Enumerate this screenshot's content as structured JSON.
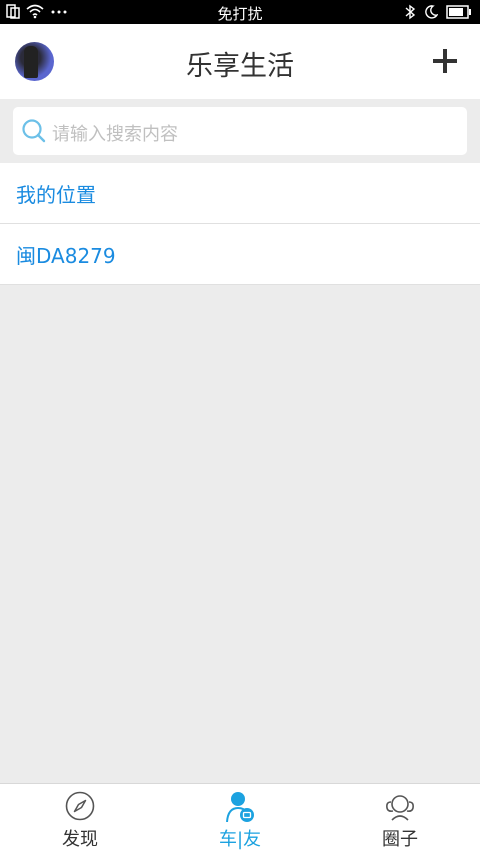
{
  "status_bar": {
    "center_text": "免打扰"
  },
  "header": {
    "title": "乐享生活"
  },
  "search": {
    "placeholder": "请输入搜索内容"
  },
  "list": {
    "items": [
      {
        "label": "我的位置"
      },
      {
        "label": "闽DA8279"
      }
    ]
  },
  "tabbar": {
    "tabs": [
      {
        "label": "发现",
        "icon": "compass-icon"
      },
      {
        "label": "车|友",
        "icon": "car-friend-icon",
        "active": true
      },
      {
        "label": "圈子",
        "icon": "circle-group-icon"
      }
    ]
  },
  "colors": {
    "accent": "#1ca2e0",
    "link": "#1a8be0",
    "background": "#ececec"
  }
}
